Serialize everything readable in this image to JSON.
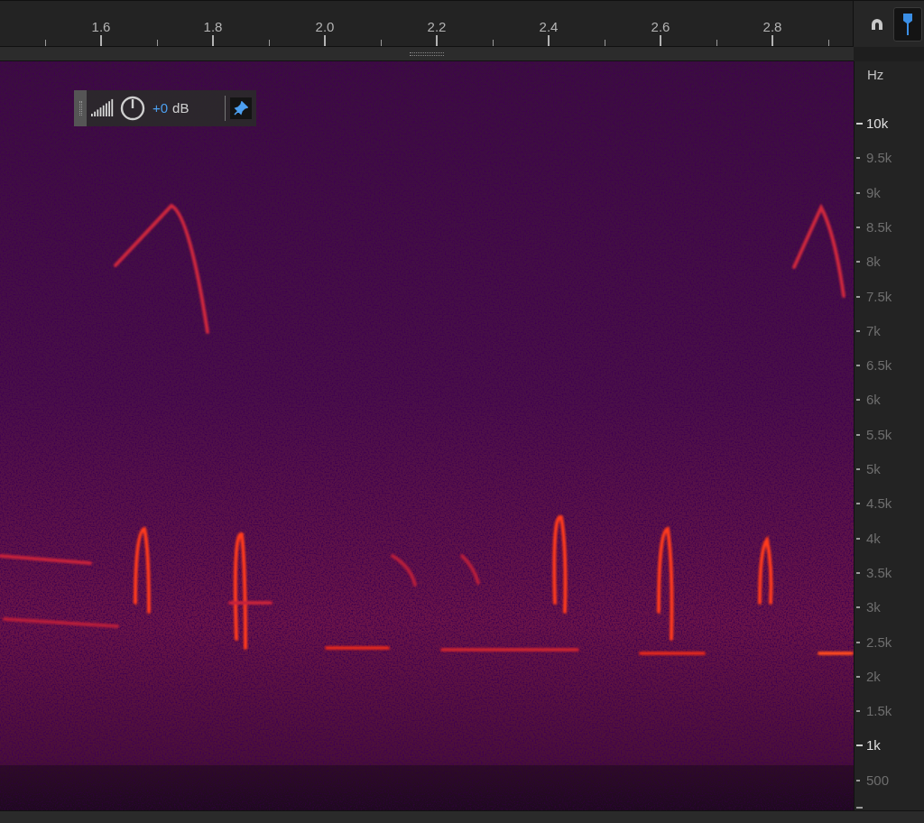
{
  "time_ruler": {
    "labels": [
      "1.6",
      "1.8",
      "2.0",
      "2.2",
      "2.4",
      "2.6",
      "2.8"
    ]
  },
  "toolbar": [
    {
      "kind": "magnet",
      "selected": false
    },
    {
      "kind": "marker",
      "selected": true
    }
  ],
  "hud": {
    "gain": "+0",
    "gain_unit": "dB",
    "pinned": true
  },
  "frequency_axis": {
    "unit": "Hz",
    "labels": [
      {
        "text": "10k",
        "emphasized": true
      },
      {
        "text": "9.5k",
        "emphasized": false
      },
      {
        "text": "9k",
        "emphasized": false
      },
      {
        "text": "8.5k",
        "emphasized": false
      },
      {
        "text": "8k",
        "emphasized": false
      },
      {
        "text": "7.5k",
        "emphasized": false
      },
      {
        "text": "7k",
        "emphasized": false
      },
      {
        "text": "6.5k",
        "emphasized": false
      },
      {
        "text": "6k",
        "emphasized": false
      },
      {
        "text": "5.5k",
        "emphasized": false
      },
      {
        "text": "5k",
        "emphasized": false
      },
      {
        "text": "4.5k",
        "emphasized": false
      },
      {
        "text": "4k",
        "emphasized": false
      },
      {
        "text": "3.5k",
        "emphasized": false
      },
      {
        "text": "3k",
        "emphasized": false
      },
      {
        "text": "2.5k",
        "emphasized": false
      },
      {
        "text": "2k",
        "emphasized": false
      },
      {
        "text": "1.5k",
        "emphasized": false
      },
      {
        "text": "1k",
        "emphasized": true
      },
      {
        "text": "500",
        "emphasized": false
      }
    ]
  }
}
